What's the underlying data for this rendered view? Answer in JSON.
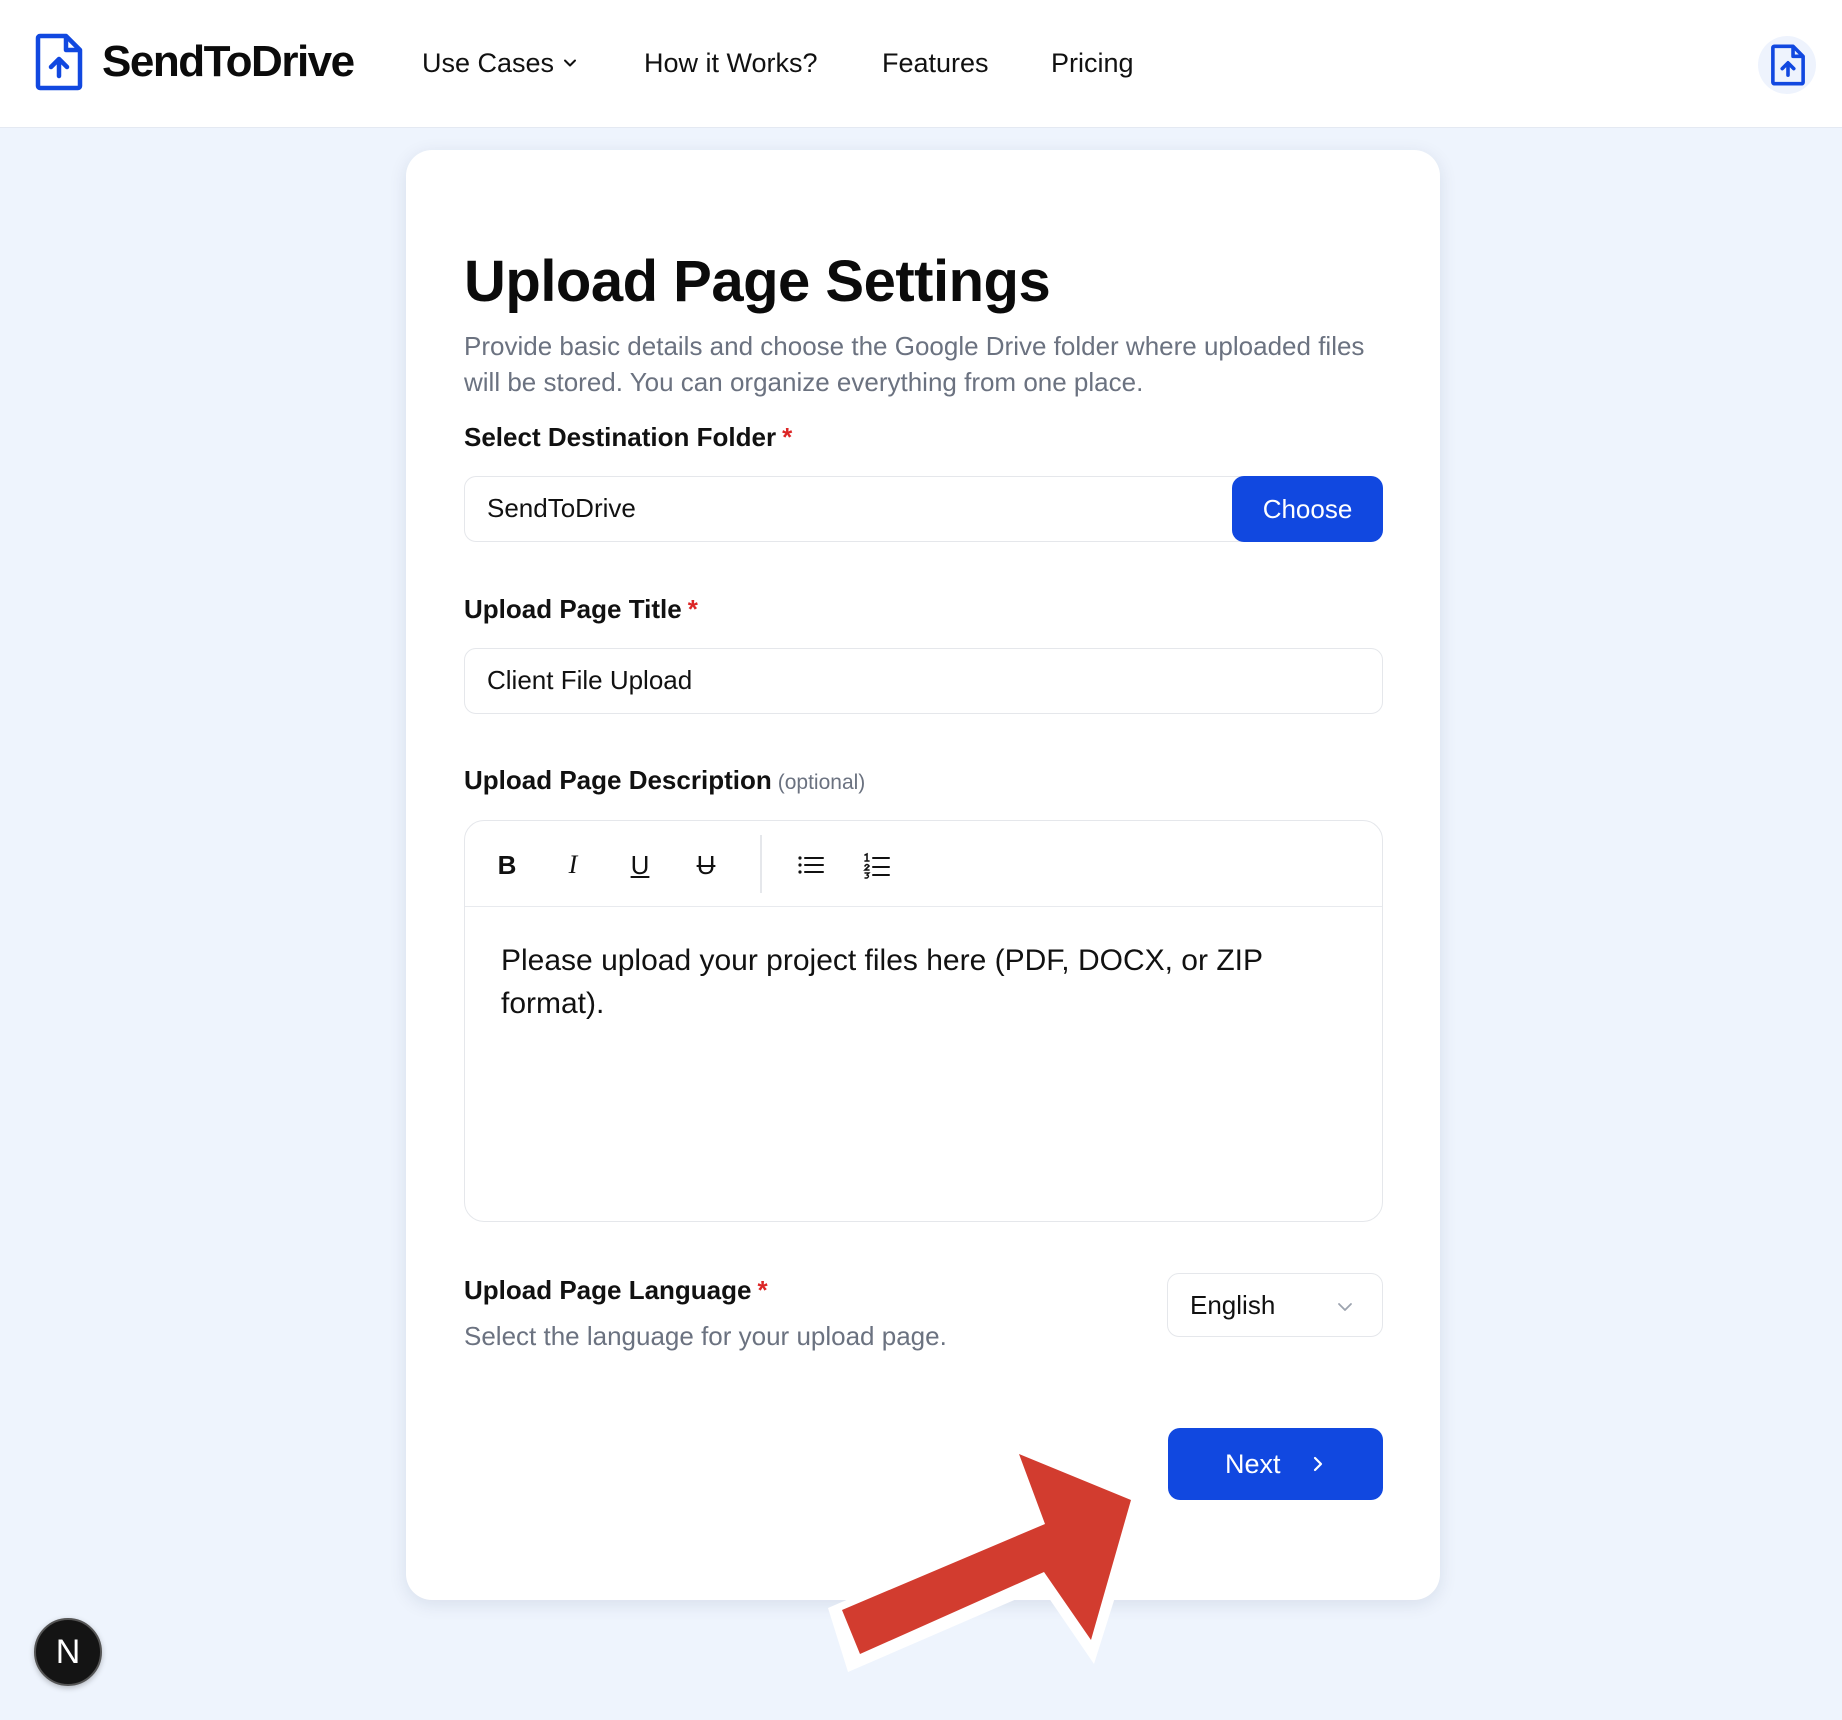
{
  "header": {
    "brand": "SendToDrive",
    "nav": [
      {
        "label": "Use Cases"
      },
      {
        "label": "How it Works?"
      },
      {
        "label": "Features"
      },
      {
        "label": "Pricing"
      }
    ],
    "brand_color": "#1148e0"
  },
  "form": {
    "title": "Upload Page Settings",
    "description": "Provide basic details and choose the Google Drive folder where uploaded files will be stored. You can organize everything from one place.",
    "folder": {
      "label": "Select Destination Folder",
      "required_mark": "*",
      "value": "SendToDrive",
      "choose_label": "Choose"
    },
    "title_field": {
      "label": "Upload Page Title",
      "required_mark": "*",
      "value": "Client File Upload"
    },
    "description_field": {
      "label": "Upload Page Description",
      "optional_label": "(optional)",
      "toolbar": {
        "bold": "B",
        "italic": "I",
        "underline": "U",
        "strike": "U"
      },
      "value": "Please upload your project files here (PDF, DOCX, or ZIP format)."
    },
    "language": {
      "label": "Upload Page Language",
      "required_mark": "*",
      "help": "Select the language for your upload page.",
      "selected": "English"
    },
    "next_label": "Next"
  },
  "badge": {
    "letter": "N"
  },
  "colors": {
    "primary": "#1148e0",
    "background": "#eef4fd",
    "required": "#dc2626",
    "annotation_arrow": "#d23c2f"
  }
}
